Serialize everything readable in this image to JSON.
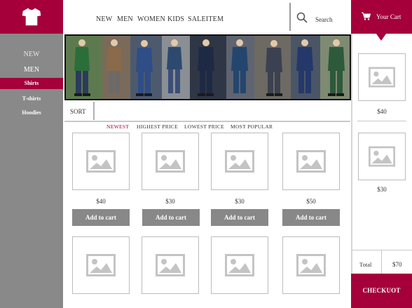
{
  "logo": {
    "icon": "tshirt-icon"
  },
  "nav": {
    "items": [
      "NEW",
      "MEN",
      "WOMEN",
      "KIDS",
      "SALEITEM"
    ]
  },
  "search": {
    "label": "Search",
    "icon": "search-icon"
  },
  "cart": {
    "title": "Your Cart",
    "icon": "cart-icon"
  },
  "sidebar": {
    "items": [
      {
        "label": "NEW"
      },
      {
        "label": "MEN"
      },
      {
        "label": "Shirts",
        "selected": true
      },
      {
        "label": "T-shirts"
      },
      {
        "label": "Hoodies"
      }
    ]
  },
  "sort": {
    "label": "SORT",
    "options": [
      "NEWEST",
      "HIGHEST PRICE",
      "LOWEST PRICE",
      "MOST POPULAR"
    ],
    "selected": "NEWEST"
  },
  "products": [
    {
      "price": "$40",
      "button": "Add to cart"
    },
    {
      "price": "$30",
      "button": "Add to cart"
    },
    {
      "price": "$30",
      "button": "Add to cart"
    },
    {
      "price": "$50",
      "button": "Add to cart"
    }
  ],
  "cart_items": [
    {
      "price": "$40"
    },
    {
      "price": "$30"
    }
  ],
  "totals": {
    "label": "Total",
    "value": "$70"
  },
  "checkout": {
    "label": "CHECKUOT"
  },
  "colors": {
    "brand": "#a5003a",
    "sidebar": "#898989",
    "button": "#888888"
  }
}
